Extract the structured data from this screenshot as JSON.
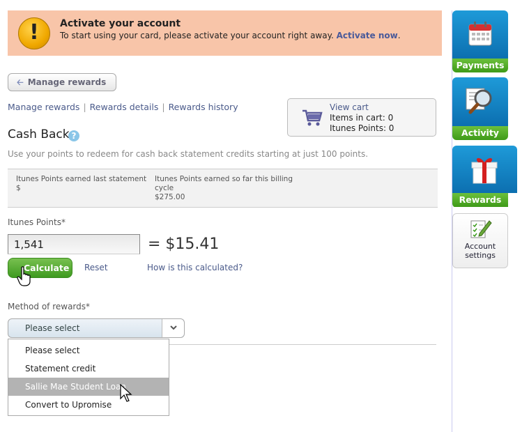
{
  "alert": {
    "title": "Activate your account",
    "text": "To start using your card, please activate your account right away.",
    "link": "Activate now",
    "link_suffix": ".",
    "icon_glyph": "!"
  },
  "back_button": {
    "label": "Manage rewards"
  },
  "subnav": {
    "items": [
      "Manage rewards",
      "Rewards details",
      "Rewards history"
    ],
    "separator": "|"
  },
  "cart": {
    "link": "View cart",
    "items_label": "Items in cart: 0",
    "points_label": "Itunes Points: 0"
  },
  "page": {
    "title": "Cash Back",
    "help_glyph": "?",
    "description": "Use your points to redeem for cash back statement credits starting at just 100 points."
  },
  "points_table": {
    "col1_label": "Itunes Points earned last statement",
    "col1_value": "$",
    "col2_label_line1": "Itunes Points earned so far this billing",
    "col2_label_line2": "cycle",
    "col2_value": "$275.00"
  },
  "calculator": {
    "label": "Itunes Points*",
    "value": "1,541",
    "result": "= $15.41",
    "calculate_label": "Calculate",
    "reset_label": "Reset",
    "how_link": "How is this calculated?"
  },
  "method": {
    "label": "Method of rewards*",
    "selected": "Please select",
    "options": [
      "Please select",
      "Statement credit",
      "Sallie Mae Student Loan",
      "Convert to Upromise"
    ],
    "highlighted_index": 2
  },
  "sidebar": {
    "tiles": [
      {
        "label": "Payments",
        "icon": "calendar-icon"
      },
      {
        "label": "Activity",
        "icon": "magnifier-icon"
      },
      {
        "label": "Rewards",
        "icon": "gift-icon"
      }
    ],
    "settings": {
      "label_line1": "Account",
      "label_line2": "settings",
      "icon": "checklist-pencil-icon"
    }
  },
  "colors": {
    "alert_bg": "#f8c5a9",
    "link": "#4a5a8a",
    "tile_blue": "#1e9ad8",
    "tile_green": "#4eaa22",
    "highlight": "#b3b3b3"
  }
}
